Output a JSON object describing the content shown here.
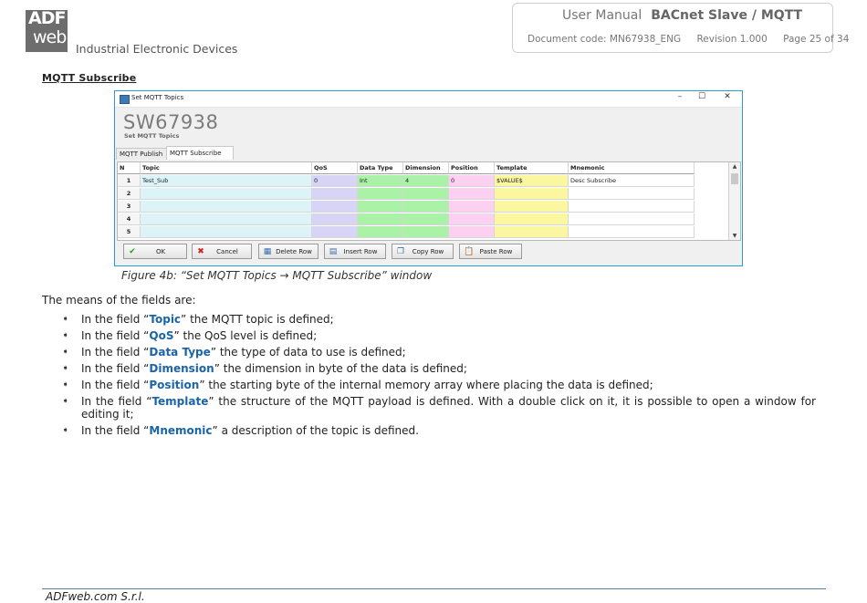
{
  "header": {
    "logo_top": "ADF",
    "logo_bottom": "web",
    "company_tagline": "Industrial Electronic Devices",
    "doc_type": "User Manual",
    "doc_title": "BACnet Slave / MQTT",
    "doc_code": "Document code: MN67938_ENG",
    "revision": "Revision 1.000",
    "page": "Page 25 of 34"
  },
  "section_title": "MQTT Subscribe",
  "window": {
    "title": "Set MQTT Topics",
    "controls": [
      "–",
      "☐",
      "✕"
    ],
    "app_name": "SW67938",
    "app_subtitle": "Set MQTT Topics",
    "tabs": [
      {
        "label": "MQTT Publish",
        "active": false
      },
      {
        "label": "MQTT Subscribe",
        "active": true
      }
    ],
    "table": {
      "columns": [
        "N",
        "Topic",
        "QoS",
        "Data Type",
        "Dimension",
        "Position",
        "Template",
        "Mnemonic"
      ],
      "rows": [
        [
          "1",
          "Test_Sub",
          "0",
          "Int",
          "4",
          "0",
          "$VALUE$",
          "Desc Subscribe"
        ],
        [
          "2",
          "",
          "",
          "",
          "",
          "",
          "",
          ""
        ],
        [
          "3",
          "",
          "",
          "",
          "",
          "",
          "",
          ""
        ],
        [
          "4",
          "",
          "",
          "",
          "",
          "",
          "",
          ""
        ],
        [
          "5",
          "",
          "",
          "",
          "",
          "",
          "",
          ""
        ]
      ],
      "column_colors": [
        "#f5f5f5",
        "#dcf4f8",
        "#d8d4f6",
        "#aaf2a8",
        "#aaf2a8",
        "#fbd0f0",
        "#fbf6a0",
        "#ffffff"
      ]
    },
    "buttons": [
      {
        "label": "OK",
        "icon": "check-icon"
      },
      {
        "label": "Cancel",
        "icon": "cross-icon"
      },
      {
        "label": "Delete Row",
        "icon": "delete-row-icon"
      },
      {
        "label": "Insert Row",
        "icon": "insert-row-icon"
      },
      {
        "label": "Copy Row",
        "icon": "copy-icon"
      },
      {
        "label": "Paste Row",
        "icon": "paste-icon"
      }
    ]
  },
  "figure_caption": "Figure 4b: “Set MQTT Topics → MQTT Subscribe” window",
  "intro": "The means of the fields are:",
  "bullets": [
    {
      "pre": "In the field “",
      "kw": "Topic",
      "post": "” the MQTT topic is defined;"
    },
    {
      "pre": "In the field “",
      "kw": "QoS",
      "post": "” the QoS level is defined;"
    },
    {
      "pre": "In the field “",
      "kw": "Data Type",
      "post": "” the type of data to use is defined;"
    },
    {
      "pre": "In the field “",
      "kw": "Dimension",
      "post": "” the dimension in byte of the data is defined;"
    },
    {
      "pre": "In the field “",
      "kw": "Position",
      "post": "” the starting byte of the internal memory array where placing the data is defined;"
    },
    {
      "pre": "In the field “",
      "kw": "Template",
      "post": "” the structure of the MQTT payload is defined. With a double click on it, it is possible to open a window for editing it;"
    },
    {
      "pre": "In the field “",
      "kw": "Mnemonic",
      "post": "” a description of the topic is defined."
    }
  ],
  "footer": "ADFweb.com S.r.l."
}
